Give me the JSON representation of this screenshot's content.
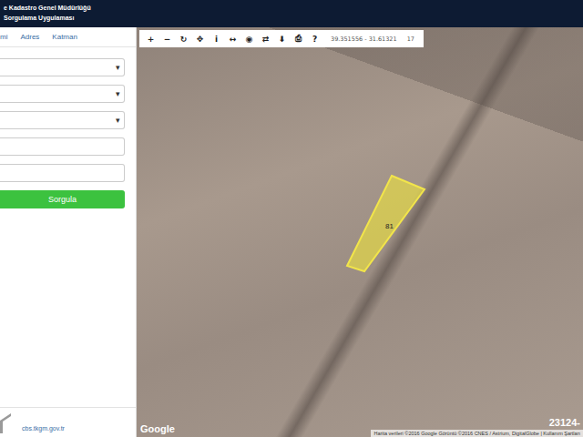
{
  "header": {
    "title": "e Kadastro Genel Müdürlüğü",
    "subtitle": "Sorgulama Uygulaması"
  },
  "tabs": [
    {
      "label": "mi"
    },
    {
      "label": "Adres"
    },
    {
      "label": "Katman"
    }
  ],
  "dropdowns": [
    {
      "arrow": "▾"
    },
    {
      "arrow": "▾"
    },
    {
      "arrow": "▾"
    }
  ],
  "inputs": [
    {
      "value": ""
    },
    {
      "value": ""
    }
  ],
  "submit_button": "Sorgula",
  "footer": {
    "link": "cbs.tkgm.gov.tr"
  },
  "toolbar": {
    "buttons": [
      "+",
      "−",
      "↻",
      "✥",
      "i",
      "↔",
      "◉",
      "⇄",
      "⬇",
      "⎙",
      "?"
    ],
    "coordinates": "39.351556 - 31.61321",
    "zoom": "17"
  },
  "map": {
    "parcel_label": "81",
    "logo": "Google",
    "attribution": "Harita verileri ©2016 Google Görüntü ©2016 CNES / Astrium, DigitalGlobe | Kullanım Şartları",
    "watermark": "23124-"
  }
}
